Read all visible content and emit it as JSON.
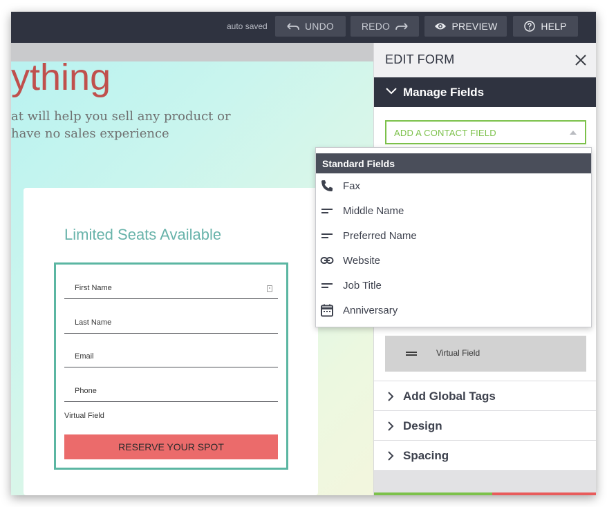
{
  "toolbar": {
    "autosave_text": "auto saved",
    "undo_label": "UNDO",
    "redo_label": "REDO",
    "preview_label": "PREVIEW",
    "help_label": "HELP"
  },
  "page": {
    "hero_title": "ything",
    "hero_sub_line1": "at will help you sell any product or",
    "hero_sub_line2": "have no sales experience",
    "card_title": "Limited Seats Available",
    "fields": [
      "First Name",
      "Last Name",
      "Email",
      "Phone"
    ],
    "virtual_field_label": "Virtual Field",
    "submit_label": "RESERVE YOUR SPOT"
  },
  "panel": {
    "title": "EDIT FORM",
    "manage_fields": "Manage Fields",
    "add_contact_field": "ADD A CONTACT FIELD",
    "virtual_field": "Virtual Field",
    "sections": [
      "Add Global Tags",
      "Design",
      "Spacing"
    ]
  },
  "dropdown": {
    "header": "Standard Fields",
    "items": [
      {
        "label": "Fax",
        "icon": "phone-icon"
      },
      {
        "label": "Middle Name",
        "icon": "short-text-icon"
      },
      {
        "label": "Preferred Name",
        "icon": "short-text-icon"
      },
      {
        "label": "Website",
        "icon": "link-icon"
      },
      {
        "label": "Job Title",
        "icon": "short-text-icon"
      },
      {
        "label": "Anniversary",
        "icon": "calendar-icon"
      }
    ]
  },
  "colors": {
    "topbar": "#2f3340",
    "accent_green": "#7cc14a",
    "form_border": "#5bb6a2",
    "submit_bg": "#eb6b6b",
    "hero_title": "#c0504d"
  }
}
